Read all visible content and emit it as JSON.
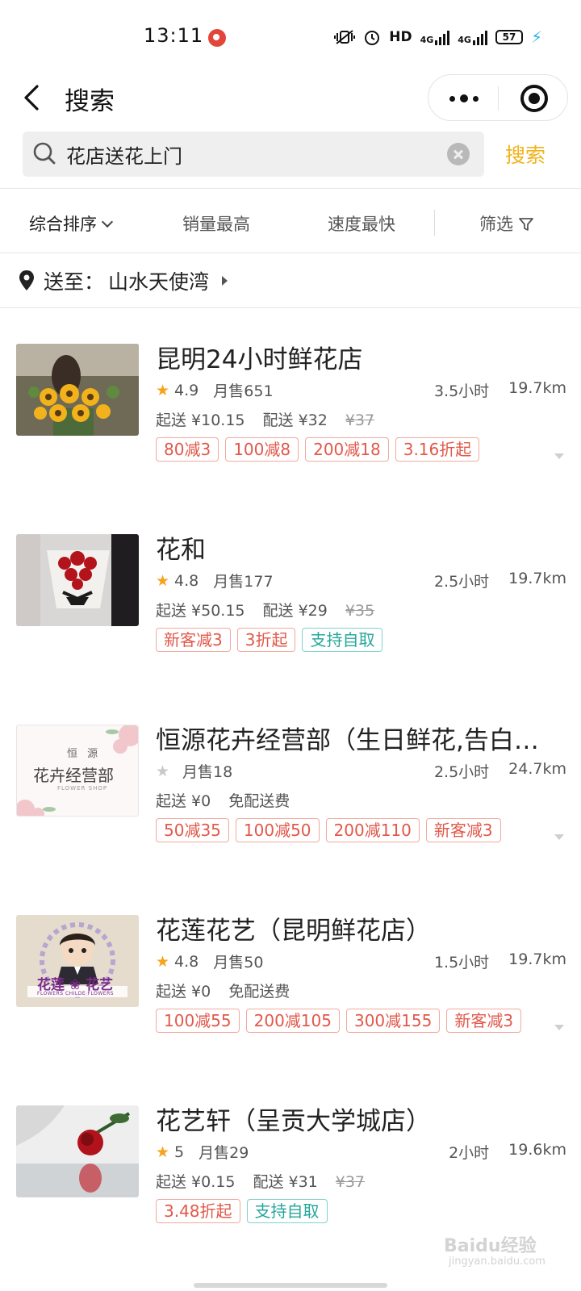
{
  "status_bar": {
    "time": "13:11",
    "hd_label": "HD",
    "net1": "4G",
    "net2": "4G",
    "battery": "57"
  },
  "header": {
    "title": "搜索"
  },
  "search": {
    "value": "花店送花上门",
    "button_label": "搜索"
  },
  "sort_bar": {
    "items": [
      "综合排序",
      "销量最高",
      "速度最快",
      "筛选"
    ]
  },
  "delivery": {
    "label": "送至：",
    "address": "山水天使湾"
  },
  "shops": [
    {
      "name": "昆明24小时鲜花店",
      "rating": "4.9",
      "monthly_sales": "月售651",
      "time": "3.5小时",
      "distance": "19.7km",
      "min_order": "起送 ¥10.15",
      "delivery_fee": "配送 ¥32",
      "original_fee": "¥37",
      "tags": [
        "80减3",
        "100减8",
        "200减18",
        "3.16折起"
      ]
    },
    {
      "name": "花和",
      "rating": "4.8",
      "monthly_sales": "月售177",
      "time": "2.5小时",
      "distance": "19.7km",
      "min_order": "起送 ¥50.15",
      "delivery_fee": "配送 ¥29",
      "original_fee": "¥35",
      "tags": [
        "新客减3",
        "3折起",
        "支持自取"
      ]
    },
    {
      "name": "恒源花卉经营部（生日鲜花,告白…",
      "rating": "",
      "monthly_sales": "月售18",
      "time": "2.5小时",
      "distance": "24.7km",
      "min_order": "起送 ¥0",
      "delivery_fee": "免配送费",
      "original_fee": "",
      "thumb_text": {
        "small": "恒 源",
        "large": "花卉经营部",
        "sub": "FLOWER SHOP"
      },
      "tags": [
        "50减35",
        "100减50",
        "200减110",
        "新客减3"
      ]
    },
    {
      "name": "花莲花艺（昆明鲜花店）",
      "rating": "4.8",
      "monthly_sales": "月售50",
      "time": "1.5小时",
      "distance": "19.7km",
      "min_order": "起送 ¥0",
      "delivery_fee": "免配送费",
      "original_fee": "",
      "thumb_text": {
        "large": "花莲 ❀ 花艺",
        "sub": "FLOWERS CHILDE FLOWERS"
      },
      "tags": [
        "100减55",
        "200减105",
        "300减155",
        "新客减3"
      ]
    },
    {
      "name": "花艺轩（呈贡大学城店）",
      "rating": "5",
      "monthly_sales": "月售29",
      "time": "2小时",
      "distance": "19.6km",
      "min_order": "起送 ¥0.15",
      "delivery_fee": "配送 ¥31",
      "original_fee": "¥37",
      "tags": [
        "3.48折起",
        "支持自取"
      ]
    }
  ],
  "watermark": {
    "text": "Baidu经验",
    "sub": "jingyan.baidu.com"
  },
  "colors": {
    "accent": "#f2b31b",
    "star": "#f7a21b",
    "tag_red": "#e2584a",
    "tag_teal": "#25a79c"
  }
}
